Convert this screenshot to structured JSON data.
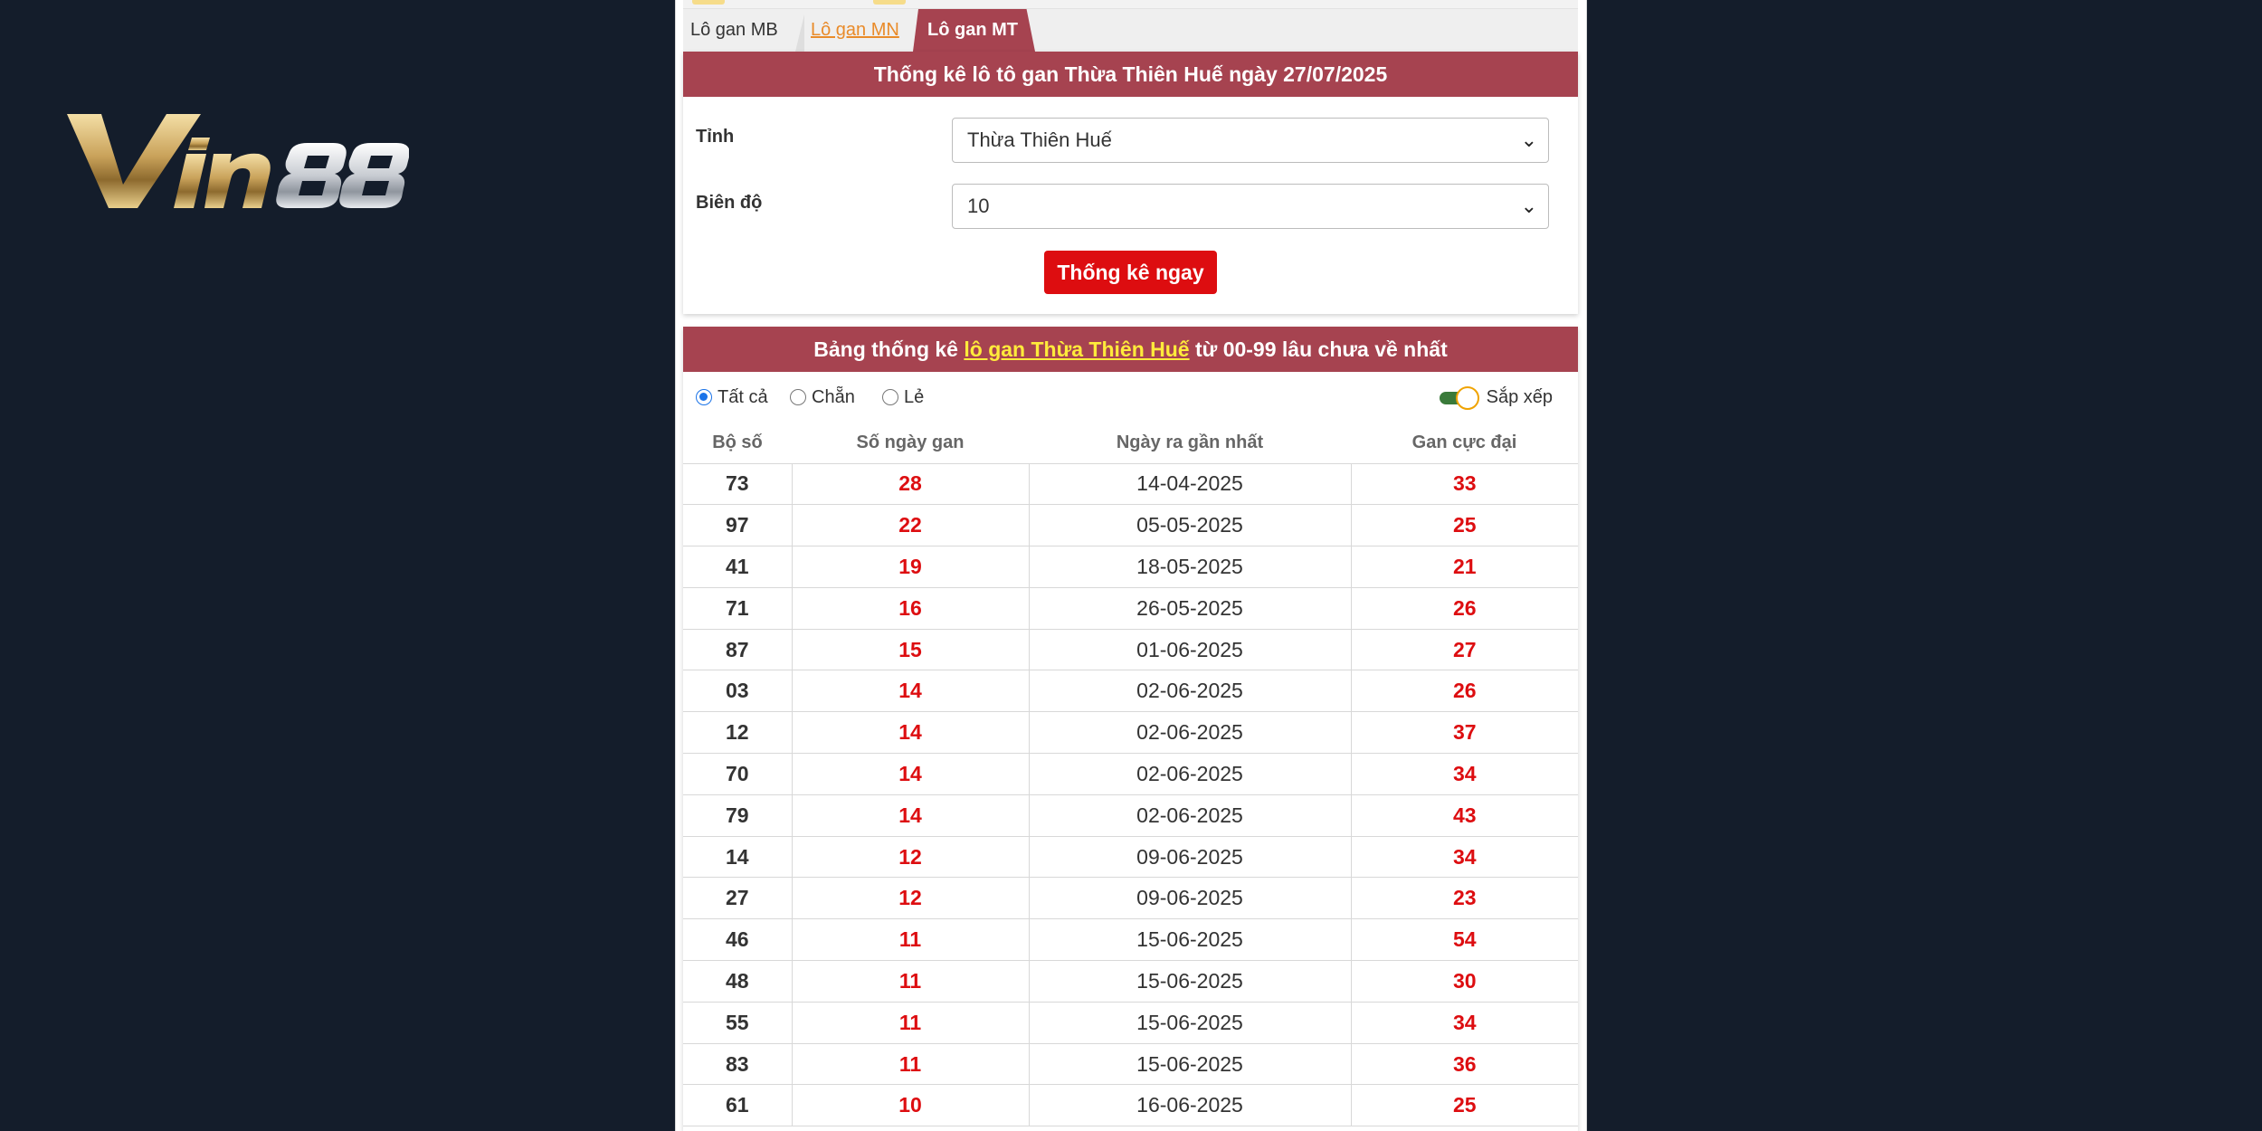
{
  "brand": {
    "logo_text": "Vin88"
  },
  "tabs": [
    {
      "label": "Lô gan MB"
    },
    {
      "label": "Lô gan MN"
    },
    {
      "label": "Lô gan MT"
    }
  ],
  "form": {
    "title": "Thống kê lô tô gan Thừa Thiên Huế ngày 27/07/2025",
    "province_label": "Tỉnh",
    "province_value": "Thừa Thiên Huế",
    "range_label": "Biên độ",
    "range_value": "10",
    "submit_label": "Thống kê ngay"
  },
  "results": {
    "title_prefix": "Bảng thống kê",
    "title_link": "lô gan Thừa Thiên Huế",
    "title_suffix": "từ 00-99 lâu chưa về nhất",
    "filters": {
      "all": "Tất cả",
      "even": "Chẵn",
      "odd": "Lẻ",
      "selected": "all"
    },
    "sort_label": "Sắp xếp",
    "columns": [
      "Bộ số",
      "Số ngày gan",
      "Ngày ra gần nhất",
      "Gan cực đại"
    ],
    "rows": [
      [
        "73",
        "28",
        "14-04-2025",
        "33"
      ],
      [
        "97",
        "22",
        "05-05-2025",
        "25"
      ],
      [
        "41",
        "19",
        "18-05-2025",
        "21"
      ],
      [
        "71",
        "16",
        "26-05-2025",
        "26"
      ],
      [
        "87",
        "15",
        "01-06-2025",
        "27"
      ],
      [
        "03",
        "14",
        "02-06-2025",
        "26"
      ],
      [
        "12",
        "14",
        "02-06-2025",
        "37"
      ],
      [
        "70",
        "14",
        "02-06-2025",
        "34"
      ],
      [
        "79",
        "14",
        "02-06-2025",
        "43"
      ],
      [
        "14",
        "12",
        "09-06-2025",
        "34"
      ],
      [
        "27",
        "12",
        "09-06-2025",
        "23"
      ],
      [
        "46",
        "11",
        "15-06-2025",
        "54"
      ],
      [
        "48",
        "11",
        "15-06-2025",
        "30"
      ],
      [
        "55",
        "11",
        "15-06-2025",
        "34"
      ],
      [
        "83",
        "11",
        "15-06-2025",
        "36"
      ],
      [
        "61",
        "10",
        "16-06-2025",
        "25"
      ]
    ]
  },
  "colors": {
    "background": "#141d2b",
    "header_red": "#a64350",
    "button_red": "#dd0d10",
    "highlight_yellow": "#ffeb3b",
    "tab_link_orange": "#e98b2a"
  }
}
